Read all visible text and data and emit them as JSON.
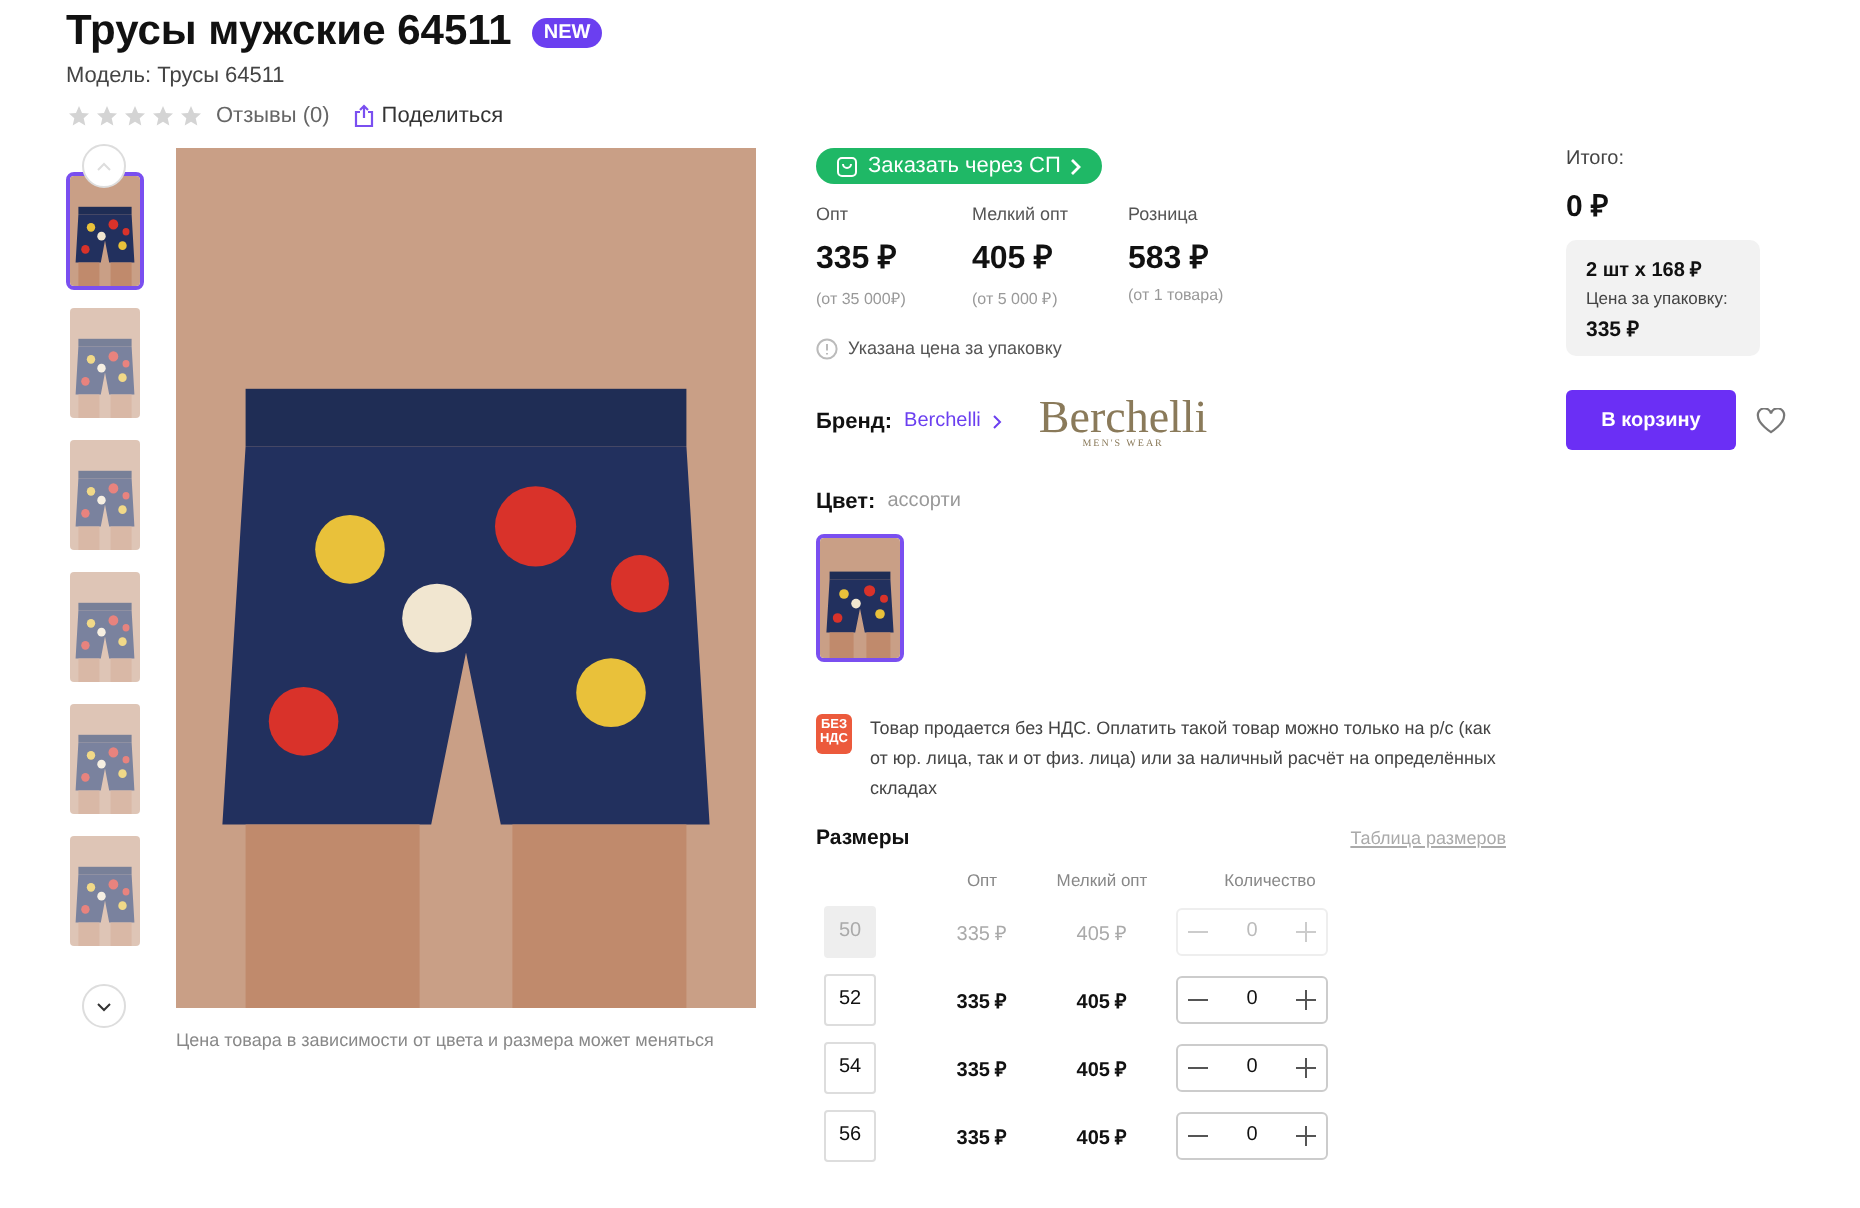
{
  "product": {
    "title": "Трусы мужские 64511",
    "badge": "NEW",
    "model": "Модель: Трусы 64511",
    "stars": 0,
    "reviews": "Отзывы (0)",
    "share": "Поделиться"
  },
  "gallery": {
    "thumbnails": [
      {
        "selected": true
      },
      {
        "selected": false
      },
      {
        "selected": false
      },
      {
        "selected": false
      },
      {
        "selected": false
      },
      {
        "selected": false
      }
    ],
    "caption": "Цена товара в зависимости от цвета и размера может меняться"
  },
  "order_button": "Заказать через СП",
  "prices": [
    {
      "label": "Опт",
      "price": "335 ₽",
      "note": "(от 35 000₽)"
    },
    {
      "label": "Мелкий опт",
      "price": "405 ₽",
      "note": "(от 5 000 ₽)"
    },
    {
      "label": "Розница",
      "price": "583 ₽",
      "note": "(от 1 товара)"
    }
  ],
  "price_hint": "Указана цена за упаковку",
  "brand": {
    "label": "Бренд:",
    "name": "Berchelli",
    "logo": "Berchelli",
    "logo_sub": "MEN'S WEAR"
  },
  "color": {
    "label": "Цвет:",
    "value": "ассорти",
    "swatches": [
      {
        "selected": true
      }
    ]
  },
  "vat": {
    "icon_top": "БЕЗ",
    "icon_bottom": "НДС",
    "text": "Товар продается без НДС. Оплатить такой товар можно только на р/с (как от юр. лица, так и от физ. лица) или за наличный расчёт на определённых складах"
  },
  "sizes": {
    "title": "Размеры",
    "table_link": "Таблица размеров",
    "columns": [
      "Опт",
      "Мелкий опт",
      "Количество"
    ],
    "rows": [
      {
        "size": "50",
        "opt": "335 ₽",
        "small_opt": "405 ₽",
        "quantity": "0",
        "disabled": true
      },
      {
        "size": "52",
        "opt": "335 ₽",
        "small_opt": "405 ₽",
        "quantity": "0",
        "disabled": false
      },
      {
        "size": "54",
        "opt": "335 ₽",
        "small_opt": "405 ₽",
        "quantity": "0",
        "disabled": false
      },
      {
        "size": "56",
        "opt": "335 ₽",
        "small_opt": "405 ₽",
        "quantity": "0",
        "disabled": false
      }
    ]
  },
  "summary": {
    "total_label": "Итого:",
    "total": "0 ₽",
    "pack": "2 шт x 168 ₽",
    "pack_label": "Цена за упаковку:",
    "pack_price": "335 ₽",
    "cart_button": "В корзину"
  }
}
